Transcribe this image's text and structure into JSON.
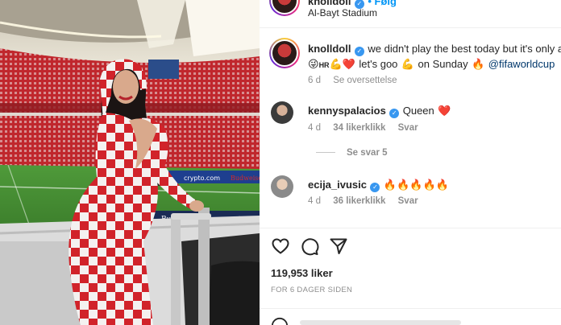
{
  "header": {
    "username": "knolldoll",
    "follow_text": "• Følg",
    "location": "Al-Bayt Stadium"
  },
  "caption": {
    "username": "knolldoll",
    "line1": "we didn't play the best today but it's only a w",
    "line2_emoji_a": "😜",
    "line2_hr": "HR",
    "line2_emoji_b": "💪❤️",
    "line2_text": "let's goo",
    "line2_emoji_c": "💪",
    "line2_text2": "on Sunday",
    "line2_emoji_d": "🔥",
    "mention": "@fifaworldcup",
    "age": "6 d",
    "translate": "Se oversettelse"
  },
  "comments": [
    {
      "username": "kennyspalacios",
      "text": "Queen",
      "emoji": "❤️",
      "age": "4 d",
      "likes": "34 likerklikk",
      "reply": "Svar",
      "view_replies": "Se svar 5"
    },
    {
      "username": "ecija_ivusic",
      "text": "",
      "emoji": "🔥🔥🔥🔥🔥",
      "age": "4 d",
      "likes": "36 likerklikk",
      "reply": "Svar"
    }
  ],
  "actions": {
    "like_icon": "heart-icon",
    "comment_icon": "comment-icon",
    "share_icon": "share-icon"
  },
  "stats": {
    "likes": "119,953 liker",
    "posted": "FOR 6 DAGER SIDEN"
  },
  "photo": {
    "ad_board_1": "crypto.com",
    "ad_board_2": "Budweiser",
    "ad_board_3": "Budweiser",
    "ad_board_4": "crypto"
  },
  "colors": {
    "link": "#00376b",
    "verified": "#3897f0",
    "meta": "#8e8e8e",
    "heart": "#ed4956"
  }
}
